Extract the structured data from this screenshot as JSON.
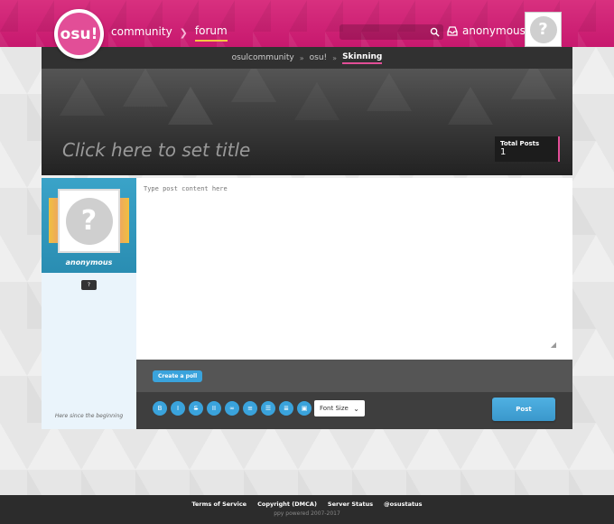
{
  "header": {
    "logo_text": "osu!",
    "nav": [
      {
        "label": "community"
      },
      {
        "label": "forum"
      }
    ],
    "search_placeholder": "",
    "user_label": "anonymous",
    "avatar_glyph": "?"
  },
  "breadcrumb": {
    "items": [
      "osulcommunity",
      "osu!",
      "Skinning"
    ]
  },
  "banner": {
    "title_placeholder": "Click here to set title",
    "stats_label": "Total Posts",
    "stats_value": "1"
  },
  "sidebar": {
    "username": "anonymous",
    "avatar_glyph": "?",
    "badge": "?",
    "since": "Here since the beginning"
  },
  "editor": {
    "placeholder": "Type post content here",
    "create_poll_label": "Create a poll",
    "font_size_label": "Font Size",
    "post_label": "Post",
    "tools": [
      {
        "glyph": "B",
        "icon": "bold-icon"
      },
      {
        "glyph": "I",
        "icon": "italic-icon"
      },
      {
        "glyph": "S",
        "icon": "strikethrough-icon"
      },
      {
        "glyph": "II",
        "icon": "heading-icon"
      },
      {
        "glyph": "∞",
        "icon": "link-icon"
      },
      {
        "glyph": "≡",
        "icon": "list-icon"
      },
      {
        "glyph": "☰",
        "icon": "numbered-list-icon"
      },
      {
        "glyph": "≣",
        "icon": "quote-icon"
      },
      {
        "glyph": "▣",
        "icon": "image-icon"
      }
    ]
  },
  "footer": {
    "links": [
      "Terms of Service",
      "Copyright (DMCA)",
      "Server Status",
      "@osustatus"
    ],
    "copyright": "ppy powered 2007-2017"
  },
  "colors": {
    "brand_pink": "#cc1f72",
    "accent_blue": "#3aa3dc",
    "nav_underline": "#f5c542"
  }
}
